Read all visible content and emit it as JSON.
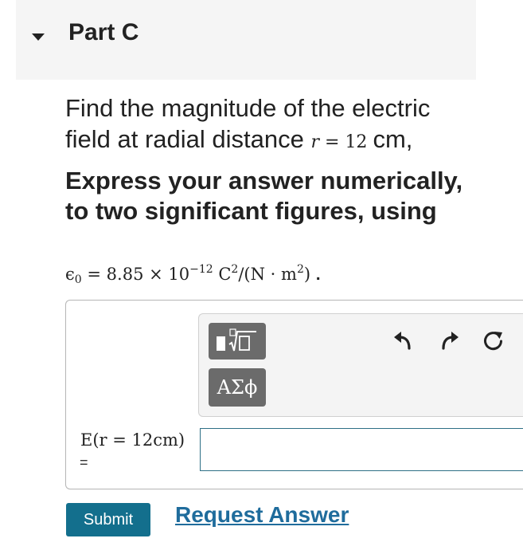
{
  "part": {
    "title": "Part C"
  },
  "question": {
    "text": "Find the magnitude of the electric field at radial distance",
    "variable": "r",
    "equals": "=",
    "value": "12",
    "unit_suffix": "cm,"
  },
  "instructions": "Express your answer numerically, to two significant figures, using",
  "constant": {
    "symbol": "ϵ",
    "subscript": "0",
    "equals": "=",
    "mantissa": "8.85 × 10",
    "exponent": "−12",
    "unit_c": "C",
    "unit_c_exp": "2",
    "unit_rest": "/(N · m",
    "unit_m_exp": "2",
    "close": ")",
    "trailing": "."
  },
  "toolbar": {
    "templates_icon": "math-templates-icon",
    "symbols_label": "ΑΣϕ",
    "undo_icon": "undo-icon",
    "redo_icon": "redo-icon",
    "reset_icon": "reset-icon"
  },
  "answer": {
    "label": "E(r = 12cm)",
    "equals": "=",
    "value": ""
  },
  "actions": {
    "submit_label": "Submit",
    "request_label": "Request Answer"
  },
  "colors": {
    "submit_bg": "#136f8d",
    "link": "#1f6c9c",
    "tool_button": "#6b6b6b",
    "input_border": "#2e6f86"
  }
}
